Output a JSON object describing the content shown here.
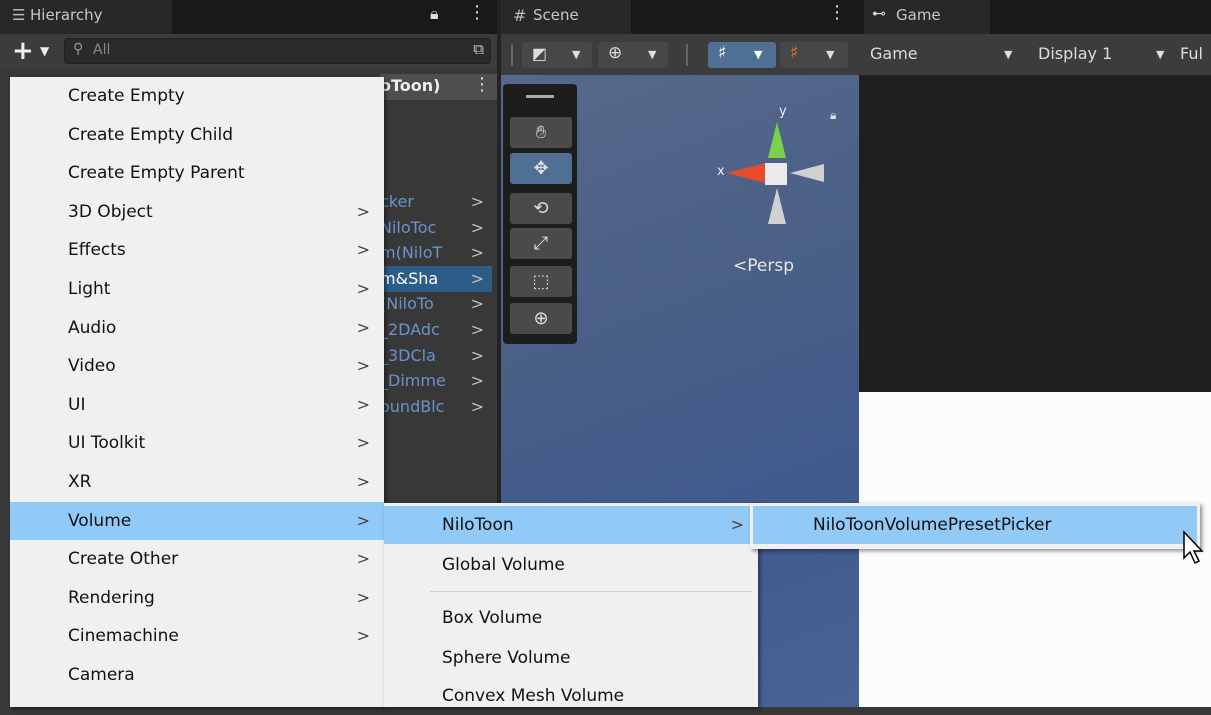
{
  "hierarchy": {
    "tab_title": "Hierarchy",
    "search_placeholder": "All",
    "header_fragment": "oToon)",
    "rows": [
      {
        "text": "cker",
        "selected": false
      },
      {
        "text": "NiloToc",
        "selected": false
      },
      {
        "text": "m(NiloT",
        "selected": false
      },
      {
        "text": "m&Sha",
        "selected": true
      },
      {
        "text": "(NiloTo",
        "selected": false
      },
      {
        "text": "_2DAdc",
        "selected": false
      },
      {
        "text": "_3DCla",
        "selected": false
      },
      {
        "text": "_Dimme",
        "selected": false
      },
      {
        "text": "oundBlc",
        "selected": false
      }
    ]
  },
  "scene": {
    "tab_title": "Scene",
    "persp_label": "Persp",
    "gizmo_y": "y",
    "gizmo_x": "x"
  },
  "game": {
    "tab_title": "Game",
    "dropdown_game": "Game",
    "dropdown_display": "Display 1",
    "dropdown_fullscreen": "Ful"
  },
  "menu_main": [
    {
      "label": "Create Empty",
      "has_sub": false
    },
    {
      "label": "Create Empty Child",
      "has_sub": false
    },
    {
      "label": "Create Empty Parent",
      "has_sub": false
    },
    {
      "label": "3D Object",
      "has_sub": true
    },
    {
      "label": "Effects",
      "has_sub": true
    },
    {
      "label": "Light",
      "has_sub": true
    },
    {
      "label": "Audio",
      "has_sub": true
    },
    {
      "label": "Video",
      "has_sub": true
    },
    {
      "label": "UI",
      "has_sub": true
    },
    {
      "label": "UI Toolkit",
      "has_sub": true
    },
    {
      "label": "XR",
      "has_sub": true
    },
    {
      "label": "Volume",
      "has_sub": true
    },
    {
      "label": "Create Other",
      "has_sub": true
    },
    {
      "label": "Rendering",
      "has_sub": true
    },
    {
      "label": "Cinemachine",
      "has_sub": true
    },
    {
      "label": "Camera",
      "has_sub": false
    }
  ],
  "menu_volume": {
    "niloToon": "NiloToon",
    "global_volume": "Global Volume",
    "box_volume": "Box Volume",
    "sphere_volume": "Sphere Volume",
    "convex_mesh_volume": "Convex Mesh Volume"
  },
  "menu_niloToon": {
    "preset_picker": "NiloToonVolumePresetPicker"
  },
  "submenu_arrow": ">"
}
